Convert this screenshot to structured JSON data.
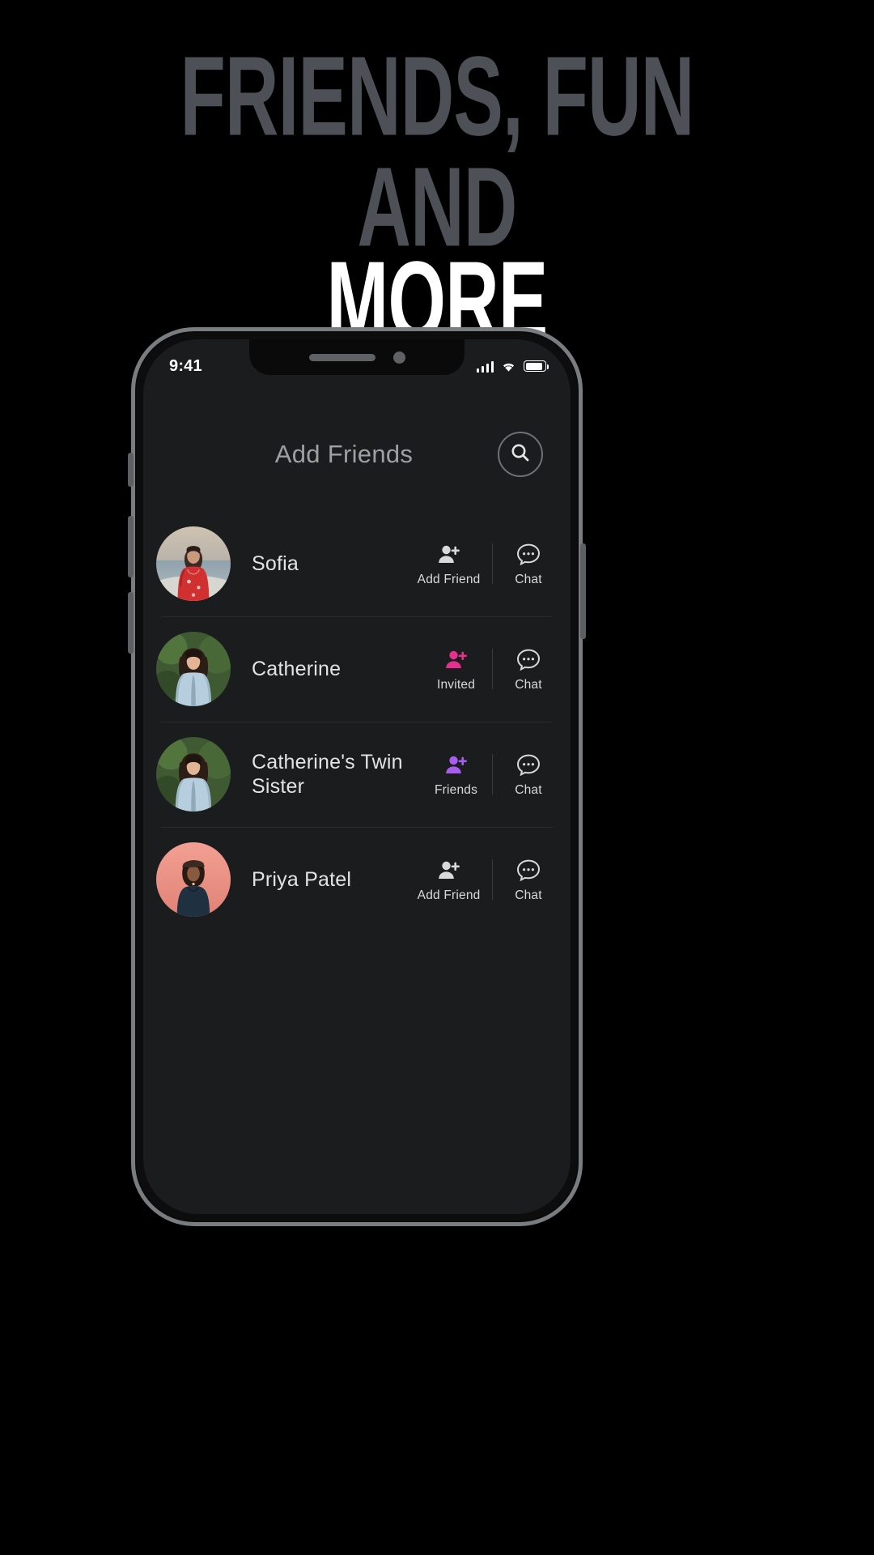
{
  "headline": {
    "line1": "FRIENDS, FUN AND",
    "line2": "MORE",
    "line1_color": "#4e5057",
    "line2_color": "#ffffff"
  },
  "status_bar": {
    "time": "9:41",
    "signal_icon": "cellular-signal-icon",
    "wifi_icon": "wifi-icon",
    "battery_icon": "battery-icon"
  },
  "app": {
    "title": "Add Friends",
    "search_icon": "search-icon"
  },
  "colors": {
    "accent_pink": "#e6308f",
    "accent_purple": "#a95cf0",
    "text_default": "#d8d9db",
    "screen_bg": "#1b1c1e"
  },
  "friends": [
    {
      "name": "Sofia",
      "avatar_name": "avatar-sofia",
      "primary": {
        "label": "Add Friend",
        "icon": "add-person-icon",
        "state": "default"
      },
      "secondary": {
        "label": "Chat",
        "icon": "chat-bubble-icon"
      }
    },
    {
      "name": "Catherine",
      "avatar_name": "avatar-catherine",
      "primary": {
        "label": "Invited",
        "icon": "add-person-icon",
        "state": "invited"
      },
      "secondary": {
        "label": "Chat",
        "icon": "chat-bubble-icon"
      }
    },
    {
      "name": "Catherine's Twin Sister",
      "avatar_name": "avatar-catherines-twin-sister",
      "primary": {
        "label": "Friends",
        "icon": "add-person-icon",
        "state": "friends"
      },
      "secondary": {
        "label": "Chat",
        "icon": "chat-bubble-icon"
      }
    },
    {
      "name": "Priya Patel",
      "avatar_name": "avatar-priya-patel",
      "primary": {
        "label": "Add Friend",
        "icon": "add-person-icon",
        "state": "default"
      },
      "secondary": {
        "label": "Chat",
        "icon": "chat-bubble-icon"
      }
    }
  ]
}
